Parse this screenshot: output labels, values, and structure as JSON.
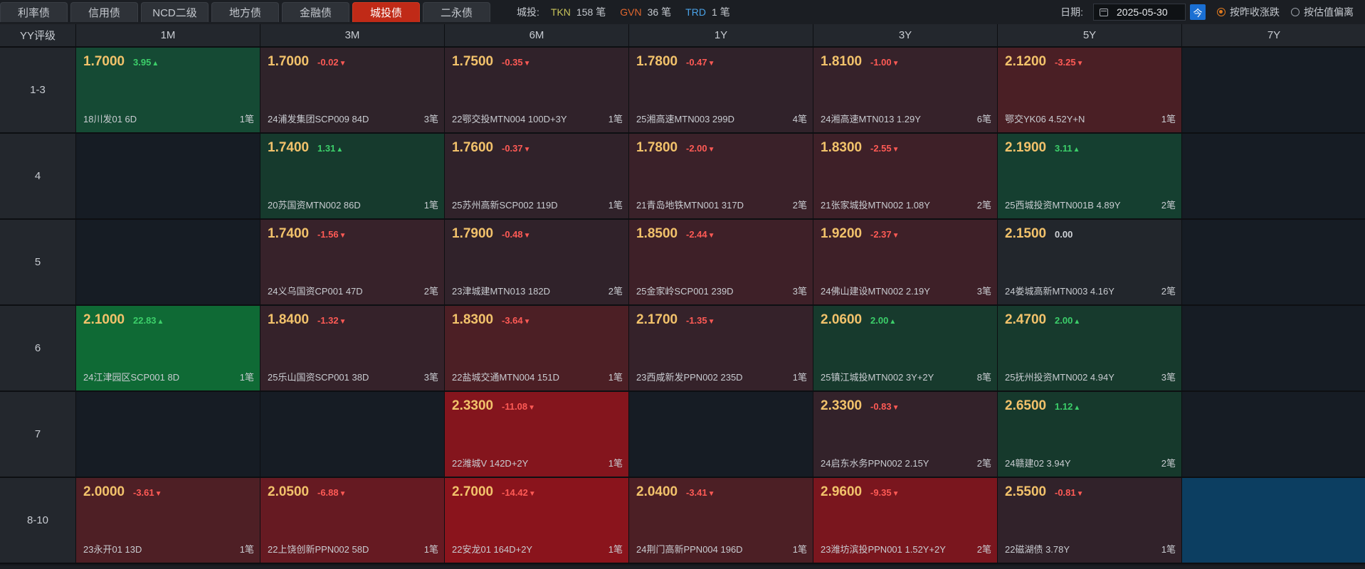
{
  "tabs": [
    {
      "label": "利率债",
      "active": false
    },
    {
      "label": "信用债",
      "active": false
    },
    {
      "label": "NCD二级",
      "active": false
    },
    {
      "label": "地方债",
      "active": false
    },
    {
      "label": "金融债",
      "active": false
    },
    {
      "label": "城投债",
      "active": true
    },
    {
      "label": "二永债",
      "active": false
    }
  ],
  "stats": {
    "label": "城投:",
    "items": [
      {
        "code": "TKN",
        "count": "158",
        "unit": "笔",
        "color": "#c7c25a"
      },
      {
        "code": "GVN",
        "count": "36",
        "unit": "笔",
        "color": "#e0662e"
      },
      {
        "code": "TRD",
        "count": "1",
        "unit": "笔",
        "color": "#4aa3e8"
      }
    ]
  },
  "controls": {
    "date_label": "日期:",
    "date_value": "2025-05-30",
    "today_label": "今",
    "radio_yield": "按昨收涨跌",
    "radio_valuation": "按估值偏离",
    "selected": "yield"
  },
  "corner_label": "YY评级",
  "columns": [
    "1M",
    "3M",
    "6M",
    "1Y",
    "3Y",
    "5Y",
    "7Y"
  ],
  "rows": [
    {
      "label": "1-3",
      "cells": [
        {
          "yield": "1.7000",
          "change": "3.95",
          "dir": "up",
          "bond": "18川发01 6D",
          "count": "1笔",
          "bg": "#154a34"
        },
        {
          "yield": "1.7000",
          "change": "-0.02",
          "dir": "down",
          "bond": "24浦发集团SCP009 84D",
          "count": "3笔",
          "bg": "#2f232a"
        },
        {
          "yield": "1.7500",
          "change": "-0.35",
          "dir": "down",
          "bond": "22鄂交投MTN004 100D+3Y",
          "count": "1笔",
          "bg": "#30222a"
        },
        {
          "yield": "1.7800",
          "change": "-0.47",
          "dir": "down",
          "bond": "25湘高速MTN003 299D",
          "count": "4笔",
          "bg": "#30222a"
        },
        {
          "yield": "1.8100",
          "change": "-1.00",
          "dir": "down",
          "bond": "24湘高速MTN013 1.29Y",
          "count": "6笔",
          "bg": "#36222a"
        },
        {
          "yield": "2.1200",
          "change": "-3.25",
          "dir": "down",
          "bond": "鄂交YK06 4.52Y+N",
          "count": "1笔",
          "bg": "#4a1f25"
        },
        null
      ]
    },
    {
      "label": "4",
      "cells": [
        null,
        {
          "yield": "1.7400",
          "change": "1.31",
          "dir": "up",
          "bond": "20苏国资MTN002 86D",
          "count": "1笔",
          "bg": "#163a2d"
        },
        {
          "yield": "1.7600",
          "change": "-0.37",
          "dir": "down",
          "bond": "25苏州高新SCP002 119D",
          "count": "1笔",
          "bg": "#30222a"
        },
        {
          "yield": "1.7800",
          "change": "-2.00",
          "dir": "down",
          "bond": "21青岛地铁MTN001 317D",
          "count": "2笔",
          "bg": "#3a2129"
        },
        {
          "yield": "1.8300",
          "change": "-2.55",
          "dir": "down",
          "bond": "21张家城投MTN002 1.08Y",
          "count": "2笔",
          "bg": "#3e2028"
        },
        {
          "yield": "2.1900",
          "change": "3.11",
          "dir": "up",
          "bond": "25西城投资MTN001B 4.89Y",
          "count": "2笔",
          "bg": "#153f30"
        },
        null
      ]
    },
    {
      "label": "5",
      "cells": [
        null,
        {
          "yield": "1.7400",
          "change": "-1.56",
          "dir": "down",
          "bond": "24义乌国资CP001 47D",
          "count": "2笔",
          "bg": "#37222a"
        },
        {
          "yield": "1.7900",
          "change": "-0.48",
          "dir": "down",
          "bond": "23津城建MTN013 182D",
          "count": "2笔",
          "bg": "#30222a"
        },
        {
          "yield": "1.8500",
          "change": "-2.44",
          "dir": "down",
          "bond": "25金家岭SCP001 239D",
          "count": "3笔",
          "bg": "#3e2028"
        },
        {
          "yield": "1.9200",
          "change": "-2.37",
          "dir": "down",
          "bond": "24佛山建设MTN002 2.19Y",
          "count": "3笔",
          "bg": "#3e2028"
        },
        {
          "yield": "2.1500",
          "change": "0.00",
          "dir": "flat",
          "bond": "24娄城高新MTN003 4.16Y",
          "count": "2笔",
          "bg": "#22262c"
        },
        null
      ]
    },
    {
      "label": "6",
      "cells": [
        {
          "yield": "2.1000",
          "change": "22.83",
          "dir": "up",
          "bond": "24江津园区SCP001 8D",
          "count": "1笔",
          "bg": "#0f6a35"
        },
        {
          "yield": "1.8400",
          "change": "-1.32",
          "dir": "down",
          "bond": "25乐山国资SCP001 38D",
          "count": "3笔",
          "bg": "#35222a"
        },
        {
          "yield": "1.8300",
          "change": "-3.64",
          "dir": "down",
          "bond": "22盐城交通MTN004 151D",
          "count": "1笔",
          "bg": "#4c1f25"
        },
        {
          "yield": "2.1700",
          "change": "-1.35",
          "dir": "down",
          "bond": "23西咸新发PPN002 235D",
          "count": "1笔",
          "bg": "#35222a"
        },
        {
          "yield": "2.0600",
          "change": "2.00",
          "dir": "up",
          "bond": "25镇江城投MTN002 3Y+2Y",
          "count": "8笔",
          "bg": "#173a2d"
        },
        {
          "yield": "2.4700",
          "change": "2.00",
          "dir": "up",
          "bond": "25抚州投资MTN002 4.94Y",
          "count": "3笔",
          "bg": "#173a2d"
        },
        null
      ]
    },
    {
      "label": "7",
      "cells": [
        null,
        null,
        {
          "yield": "2.3300",
          "change": "-11.08",
          "dir": "down",
          "bond": "22潍城V 142D+2Y",
          "count": "1笔",
          "bg": "#84151d"
        },
        null,
        {
          "yield": "2.3300",
          "change": "-0.83",
          "dir": "down",
          "bond": "24启东水务PPN002 2.15Y",
          "count": "2笔",
          "bg": "#33222a"
        },
        {
          "yield": "2.6500",
          "change": "1.12",
          "dir": "up",
          "bond": "24赣建02 3.94Y",
          "count": "2笔",
          "bg": "#16392c"
        },
        null
      ]
    },
    {
      "label": "8-10",
      "cells": [
        {
          "yield": "2.0000",
          "change": "-3.61",
          "dir": "down",
          "bond": "23永开01 13D",
          "count": "1笔",
          "bg": "#4e1f25"
        },
        {
          "yield": "2.0500",
          "change": "-6.88",
          "dir": "down",
          "bond": "22上饶创新PPN002 58D",
          "count": "1笔",
          "bg": "#661a22"
        },
        {
          "yield": "2.7000",
          "change": "-14.42",
          "dir": "down",
          "bond": "22安龙01 164D+2Y",
          "count": "1笔",
          "bg": "#8a141c"
        },
        {
          "yield": "2.0400",
          "change": "-3.41",
          "dir": "down",
          "bond": "24荆门高新PPN004 196D",
          "count": "1笔",
          "bg": "#4c1f25"
        },
        {
          "yield": "2.9600",
          "change": "-9.35",
          "dir": "down",
          "bond": "23潍坊滨投PPN001 1.52Y+2Y",
          "count": "2笔",
          "bg": "#7a161e"
        },
        {
          "yield": "2.5500",
          "change": "-0.81",
          "dir": "down",
          "bond": "22磁湖债 3.78Y",
          "count": "1笔",
          "bg": "#31222a"
        },
        {
          "empty_highlight": true
        }
      ]
    }
  ]
}
